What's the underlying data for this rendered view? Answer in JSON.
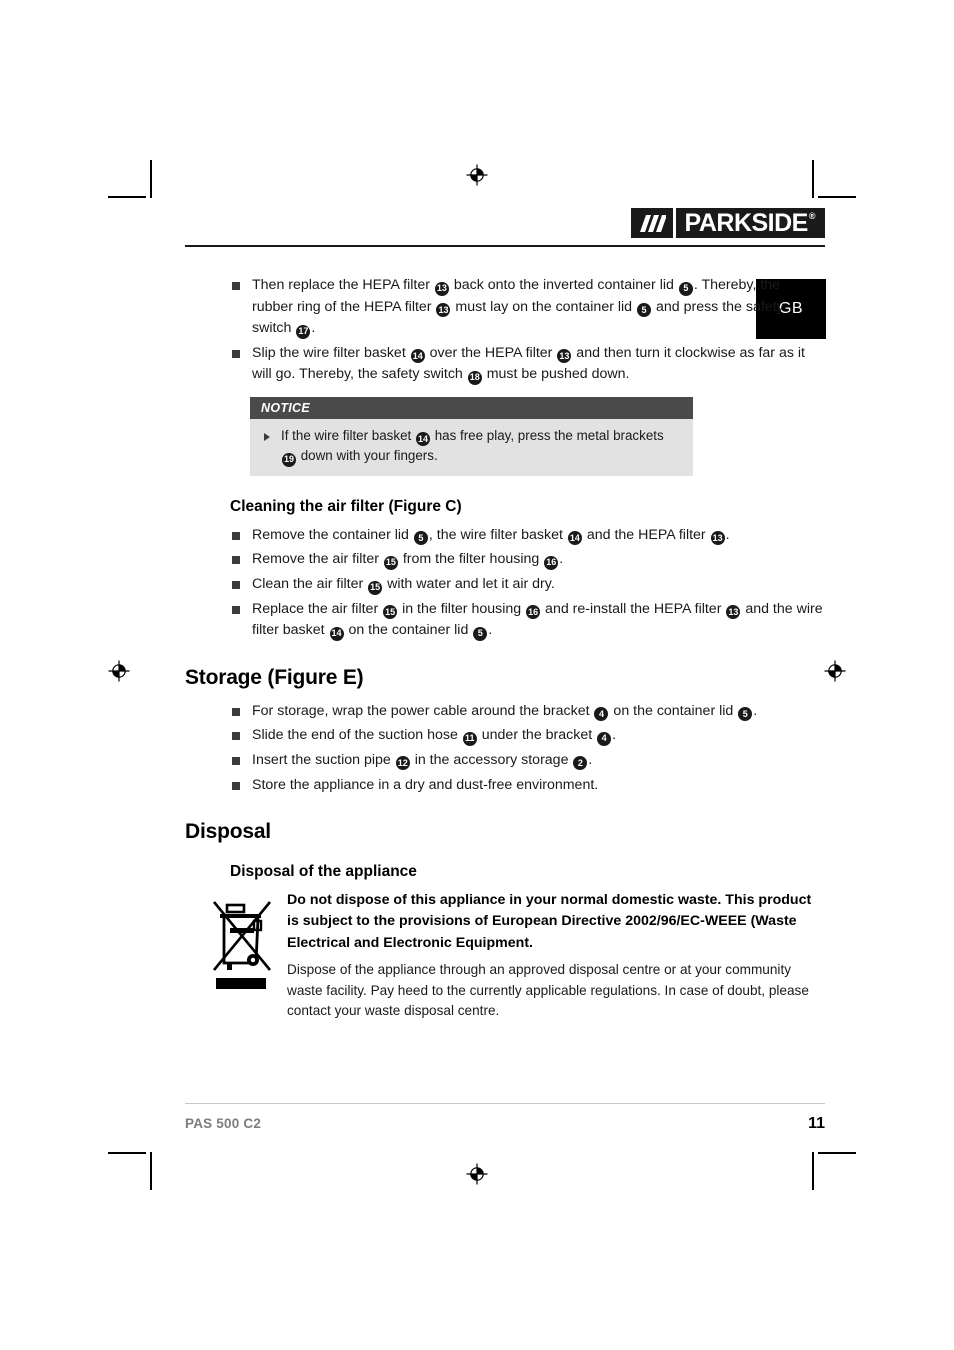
{
  "brand": {
    "logo_text": "PARKSIDE",
    "logo_registered": "®",
    "slashes_icon": "three-slashes-icon"
  },
  "language_tab": {
    "label": "GB"
  },
  "top_bullets": [
    {
      "parts": [
        {
          "t": "text",
          "v": "Then replace the HEPA filter "
        },
        {
          "t": "ref",
          "v": "13"
        },
        {
          "t": "text",
          "v": " back onto the inverted container lid "
        },
        {
          "t": "ref",
          "v": "5"
        },
        {
          "t": "text",
          "v": ". Thereby, the rubber ring of the HEPA filter "
        },
        {
          "t": "ref",
          "v": "13"
        },
        {
          "t": "text",
          "v": " must lay on the container lid "
        },
        {
          "t": "ref",
          "v": "5"
        },
        {
          "t": "text",
          "v": " and press the safety switch "
        },
        {
          "t": "ref",
          "v": "17"
        },
        {
          "t": "text",
          "v": "."
        }
      ]
    },
    {
      "parts": [
        {
          "t": "text",
          "v": "Slip the wire filter basket "
        },
        {
          "t": "ref",
          "v": "14"
        },
        {
          "t": "text",
          "v": " over the HEPA filter "
        },
        {
          "t": "ref",
          "v": "13"
        },
        {
          "t": "text",
          "v": " and then turn it clockwise as far as it will go. Thereby, the safety switch "
        },
        {
          "t": "ref",
          "v": "18"
        },
        {
          "t": "text",
          "v": " must be pushed down."
        }
      ]
    }
  ],
  "notice": {
    "title": "NOTICE",
    "items": [
      {
        "parts": [
          {
            "t": "text",
            "v": "If the wire filter basket "
          },
          {
            "t": "ref",
            "v": "14"
          },
          {
            "t": "text",
            "v": " has free play, press the metal brackets "
          },
          {
            "t": "ref",
            "v": "19"
          },
          {
            "t": "text",
            "v": " down with your fingers."
          }
        ]
      }
    ]
  },
  "section_cleaning": {
    "heading": "Cleaning the air filter (Figure C)",
    "bullets": [
      {
        "parts": [
          {
            "t": "text",
            "v": "Remove the container lid "
          },
          {
            "t": "ref",
            "v": "5"
          },
          {
            "t": "text",
            "v": ", the wire filter basket "
          },
          {
            "t": "ref",
            "v": "14"
          },
          {
            "t": "text",
            "v": " and the HEPA filter "
          },
          {
            "t": "ref",
            "v": "13"
          },
          {
            "t": "text",
            "v": "."
          }
        ]
      },
      {
        "parts": [
          {
            "t": "text",
            "v": "Remove the air filter "
          },
          {
            "t": "ref",
            "v": "15"
          },
          {
            "t": "text",
            "v": " from the filter housing "
          },
          {
            "t": "ref",
            "v": "16"
          },
          {
            "t": "text",
            "v": "."
          }
        ]
      },
      {
        "parts": [
          {
            "t": "text",
            "v": "Clean the air filter "
          },
          {
            "t": "ref",
            "v": "15"
          },
          {
            "t": "text",
            "v": " with water and let it air dry."
          }
        ]
      },
      {
        "parts": [
          {
            "t": "text",
            "v": "Replace the air filter "
          },
          {
            "t": "ref",
            "v": "15"
          },
          {
            "t": "text",
            "v": " in the filter housing "
          },
          {
            "t": "ref",
            "v": "16"
          },
          {
            "t": "text",
            "v": " and re-install the HEPA filter "
          },
          {
            "t": "ref",
            "v": "13"
          },
          {
            "t": "text",
            "v": " and the wire filter basket "
          },
          {
            "t": "ref",
            "v": "14"
          },
          {
            "t": "text",
            "v": " on the container lid "
          },
          {
            "t": "ref",
            "v": "5"
          },
          {
            "t": "text",
            "v": "."
          }
        ]
      }
    ]
  },
  "section_storage": {
    "heading": "Storage (Figure E)",
    "bullets": [
      {
        "parts": [
          {
            "t": "text",
            "v": "For storage, wrap the power cable around the bracket "
          },
          {
            "t": "ref",
            "v": "4"
          },
          {
            "t": "text",
            "v": " on the container lid "
          },
          {
            "t": "ref",
            "v": "5"
          },
          {
            "t": "text",
            "v": "."
          }
        ]
      },
      {
        "parts": [
          {
            "t": "text",
            "v": "Slide the end of the suction hose "
          },
          {
            "t": "ref",
            "v": "11"
          },
          {
            "t": "text",
            "v": " under the bracket "
          },
          {
            "t": "ref",
            "v": "4"
          },
          {
            "t": "text",
            "v": "."
          }
        ]
      },
      {
        "parts": [
          {
            "t": "text",
            "v": "Insert the suction pipe "
          },
          {
            "t": "ref",
            "v": "12"
          },
          {
            "t": "text",
            "v": " in the accessory storage "
          },
          {
            "t": "ref",
            "v": "2"
          },
          {
            "t": "text",
            "v": "."
          }
        ]
      },
      {
        "parts": [
          {
            "t": "text",
            "v": "Store the appliance in a dry and dust-free environment."
          }
        ]
      }
    ]
  },
  "section_disposal": {
    "heading": "Disposal",
    "subheading": "Disposal of the appliance",
    "icon": "crossed-out-wheelie-bin-icon",
    "bold_text": "Do not dispose of this appliance in your normal domestic waste. This product is subject to the provisions of European Directive 2002/96/EC-WEEE (Waste Electrical and Electronic Equipment.",
    "paragraph": "Dispose of the appliance through an approved disposal centre or at your community waste facility. Pay heed to the currently applicable regulations. In case of doubt, please contact your waste disposal centre."
  },
  "footer": {
    "model": "PAS 500 C2",
    "page_number": "11"
  },
  "colors": {
    "ink": "#1a1a1a",
    "notice_header_bg": "#4a4a4a",
    "notice_body_bg": "#e2e2e2",
    "footer_model": "#7d7d7d",
    "tab_bg": "#000000"
  }
}
